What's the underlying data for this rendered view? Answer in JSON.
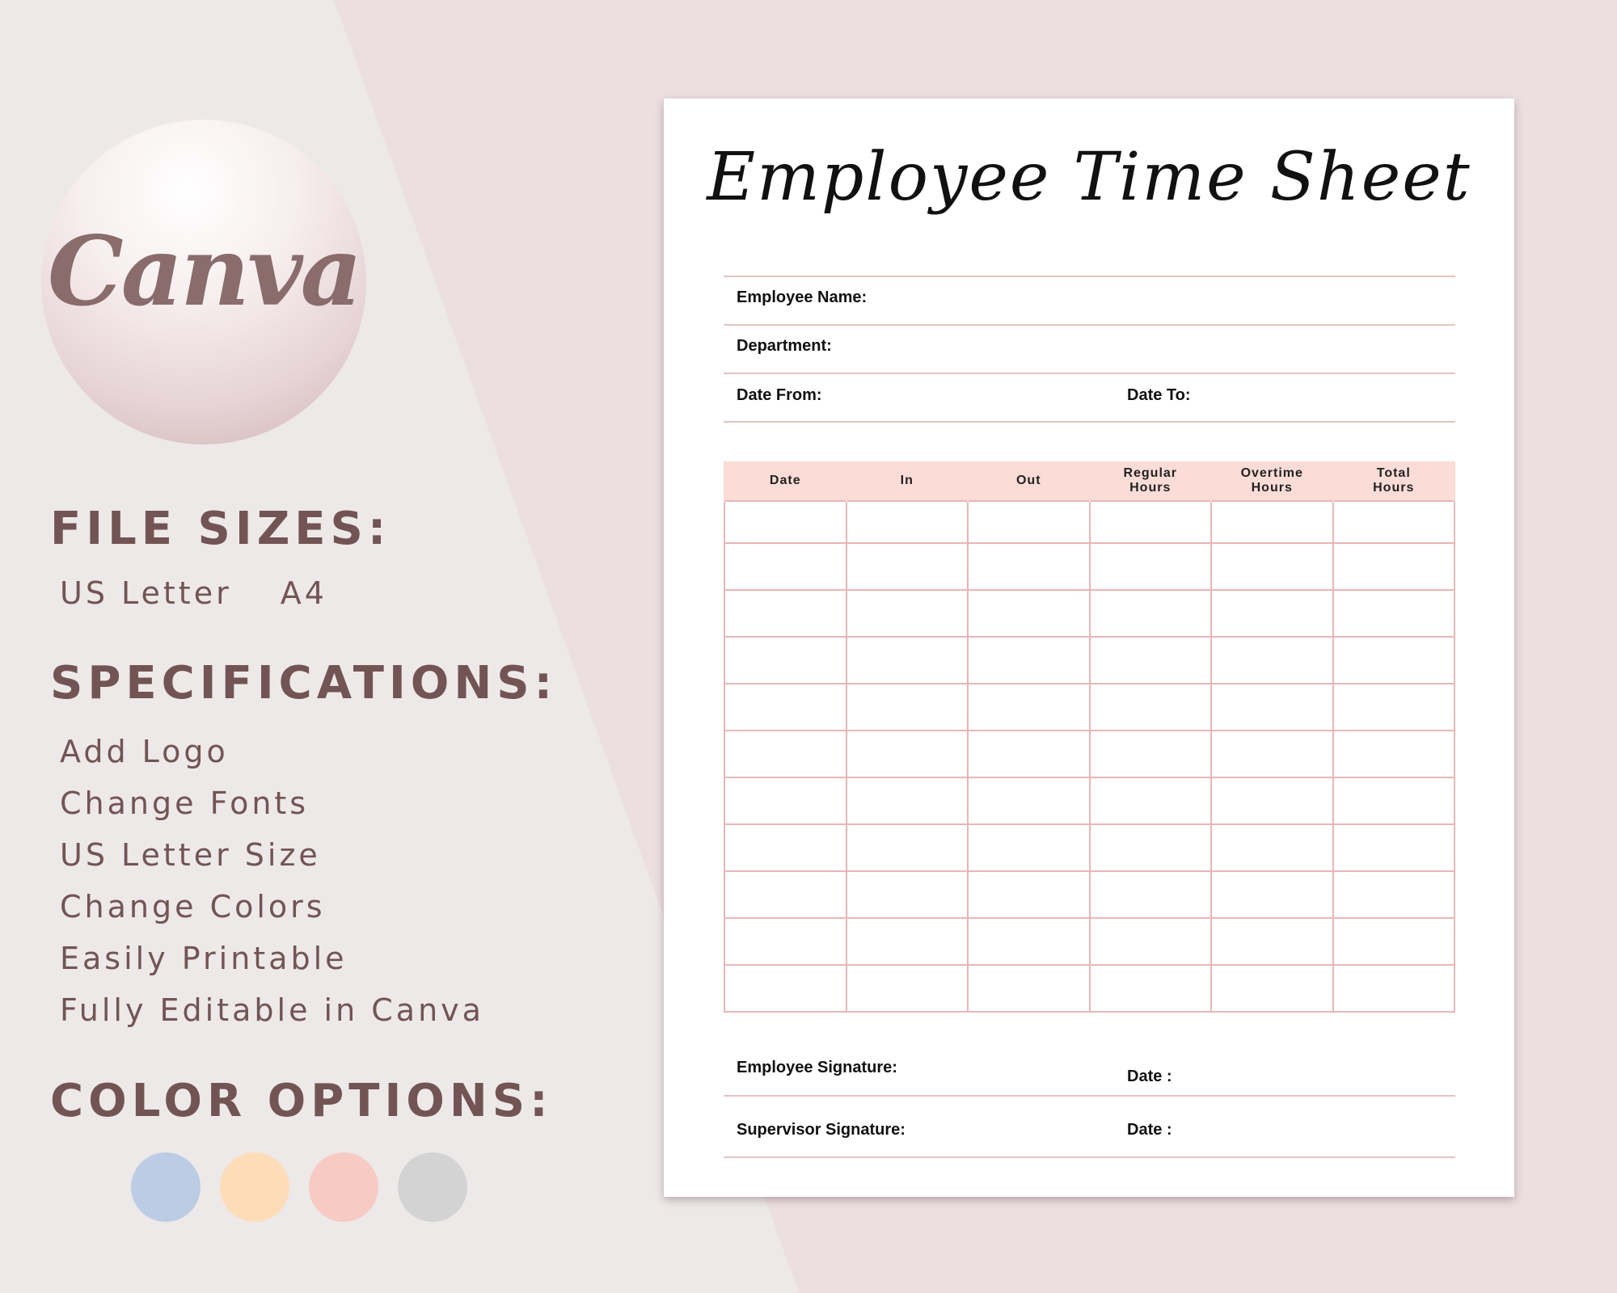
{
  "logo": {
    "text": "Canva"
  },
  "file_sizes": {
    "heading": "FILE SIZES:",
    "items": [
      "US Letter",
      "A4"
    ]
  },
  "specifications": {
    "heading": "SPECIFICATIONS:",
    "items": [
      "Add Logo",
      "Change Fonts",
      "US Letter Size",
      "Change Colors",
      "Easily Printable",
      "Fully Editable in Canva"
    ]
  },
  "color_options": {
    "heading": "COLOR OPTIONS:",
    "swatches": [
      {
        "name": "blue",
        "hex": "#bccce5"
      },
      {
        "name": "peach",
        "hex": "#fdddb8"
      },
      {
        "name": "pink",
        "hex": "#f7cbc3"
      },
      {
        "name": "gray",
        "hex": "#d3d3d3"
      }
    ]
  },
  "sheet": {
    "title": "Employee Time Sheet",
    "fields": {
      "employee_name": "Employee Name:",
      "department": "Department:",
      "date_from": "Date From:",
      "date_to": "Date To:"
    },
    "table": {
      "columns": [
        [
          "Date"
        ],
        [
          "In"
        ],
        [
          "Out"
        ],
        [
          "Regular",
          "Hours"
        ],
        [
          "Overtime",
          "Hours"
        ],
        [
          "Total",
          "Hours"
        ]
      ],
      "row_count": 11
    },
    "signatures": {
      "employee_signature": "Employee Signature:",
      "employee_date": "Date :",
      "supervisor_signature": "Supervisor Signature:",
      "supervisor_date": "Date :"
    }
  },
  "colors": {
    "text_brown": "#735455",
    "header_fill": "#fcdcd6",
    "grid_line": "#e8b7b7"
  }
}
